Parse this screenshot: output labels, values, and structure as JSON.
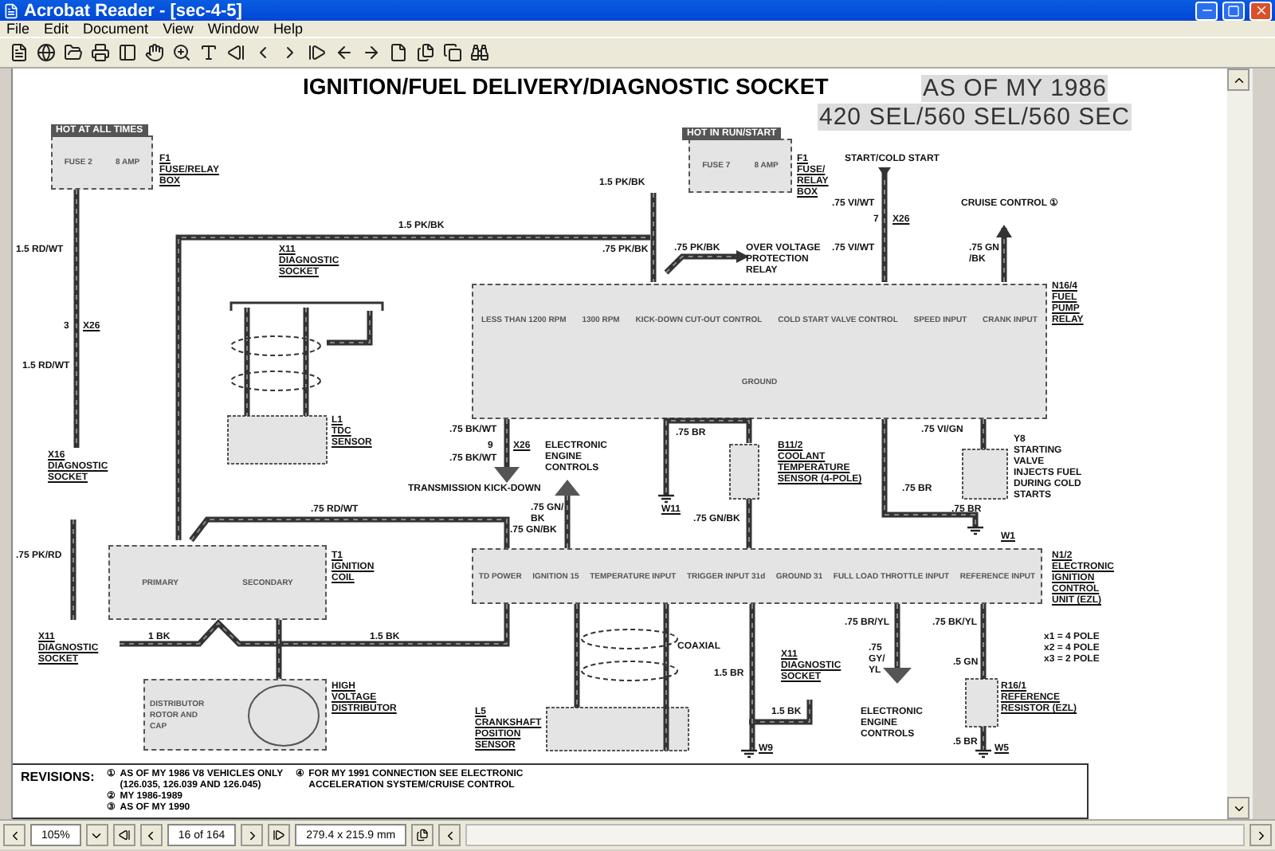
{
  "window": {
    "title": "Acrobat Reader - [sec-4-5]"
  },
  "menu": [
    "File",
    "Edit",
    "Document",
    "View",
    "Window",
    "Help"
  ],
  "document": {
    "title": "IGNITION/FUEL DELIVERY/DIAGNOSTIC SOCKET",
    "edition": "AS OF MY 1986",
    "models": "420 SEL/560 SEL/560 SEC",
    "tags": [
      "HOT AT ALL TIMES",
      "HOT IN RUN/START"
    ],
    "components": [
      {
        "lines": [
          "FUSE 2",
          "8 AMP"
        ]
      },
      {
        "lines": [
          "FUSE 7",
          "8 AMP"
        ]
      },
      {
        "lines": [
          "LESS THAN 1200 RPM",
          "1300 RPM",
          "KICK-DOWN CUT-OUT CONTROL",
          "COLD START VALVE CONTROL",
          "SPEED INPUT",
          "CRANK INPUT",
          "GROUND"
        ]
      },
      {
        "lines": [
          "PRIMARY",
          "SECONDARY"
        ]
      },
      {
        "lines": [
          "TD POWER",
          "IGNITION 15",
          "TEMPERATURE INPUT",
          "TRIGGER INPUT 31d",
          "GROUND 31",
          "FULL LOAD THROTTLE INPUT",
          "REFERENCE INPUT"
        ]
      },
      {
        "lines": [
          "DISTRIBUTOR",
          "ROTOR AND",
          "CAP"
        ]
      }
    ],
    "labels": [
      {
        "lines": [
          "F1",
          "FUSE/RELAY",
          "BOX"
        ],
        "underlined": true
      },
      {
        "lines": [
          "F1",
          "FUSE/",
          "RELAY",
          "BOX"
        ],
        "underlined": true
      },
      {
        "lines": [
          "START/COLD START"
        ],
        "underlined": false
      },
      {
        "lines": [
          "1.5 PK/BK"
        ],
        "underlined": false
      },
      {
        "lines": [
          ".75 VI/WT"
        ],
        "underlined": false
      },
      {
        "lines": [
          "CRUISE CONTROL ①"
        ],
        "underlined": false
      },
      {
        "lines": [
          "1.5 PK/BK"
        ],
        "underlined": false
      },
      {
        "lines": [
          "7"
        ],
        "underlined": false
      },
      {
        "lines": [
          "X26"
        ],
        "underlined": true
      },
      {
        "lines": [
          "1.5 RD/WT"
        ],
        "underlined": false
      },
      {
        "lines": [
          "X11",
          "DIAGNOSTIC",
          "SOCKET"
        ],
        "underlined": true
      },
      {
        "lines": [
          ".75 PK/BK"
        ],
        "underlined": false
      },
      {
        "lines": [
          ".75 PK/BK"
        ],
        "underlined": false
      },
      {
        "lines": [
          "OVER VOLTAGE",
          "PROTECTION",
          "RELAY"
        ],
        "underlined": false
      },
      {
        "lines": [
          ".75 VI/WT"
        ],
        "underlined": false
      },
      {
        "lines": [
          ".75 GN",
          "/BK"
        ],
        "underlined": false
      },
      {
        "lines": [
          "N16/4",
          "FUEL",
          "PUMP",
          "RELAY"
        ],
        "underlined": true
      },
      {
        "lines": [
          "3"
        ],
        "underlined": false
      },
      {
        "lines": [
          "X26"
        ],
        "underlined": true
      },
      {
        "lines": [
          "1.5 RD/WT"
        ],
        "underlined": false
      },
      {
        "lines": [
          "L1",
          "TDC",
          "SENSOR"
        ],
        "underlined": true
      },
      {
        "lines": [
          ".75 BK/WT"
        ],
        "underlined": false
      },
      {
        "lines": [
          ".75 BR"
        ],
        "underlined": false
      },
      {
        "lines": [
          ".75 VI/GN"
        ],
        "underlined": false
      },
      {
        "lines": [
          "X16",
          "DIAGNOSTIC",
          "SOCKET"
        ],
        "underlined": true
      },
      {
        "lines": [
          "9"
        ],
        "underlined": false
      },
      {
        "lines": [
          "X26"
        ],
        "underlined": true
      },
      {
        "lines": [
          ".75 BK/WT"
        ],
        "underlined": false
      },
      {
        "lines": [
          "ELECTRONIC",
          "ENGINE",
          "CONTROLS"
        ],
        "underlined": false
      },
      {
        "lines": [
          "TRANSMISSION KICK-DOWN"
        ],
        "underlined": false
      },
      {
        "lines": [
          "B11/2",
          "COOLANT",
          "TEMPERATURE",
          "SENSOR (4-POLE)"
        ],
        "underlined": true
      },
      {
        "lines": [
          ".75 BR"
        ],
        "underlined": false
      },
      {
        "lines": [
          "Y8",
          "STARTING",
          "VALVE",
          "INJECTS FUEL",
          "DURING COLD",
          "STARTS"
        ],
        "underlined": false
      },
      {
        "lines": [
          ".75 RD/WT"
        ],
        "underlined": false
      },
      {
        "lines": [
          ".75 GN/",
          "BK"
        ],
        "underlined": false
      },
      {
        "lines": [
          "W11"
        ],
        "underlined": true
      },
      {
        "lines": [
          ".75 GN/BK"
        ],
        "underlined": false
      },
      {
        "lines": [
          ".75 BR"
        ],
        "underlined": false
      },
      {
        "lines": [
          ".75 GN/BK"
        ],
        "underlined": false
      },
      {
        "lines": [
          "W1"
        ],
        "underlined": true
      },
      {
        "lines": [
          ".75 PK/RD"
        ],
        "underlined": false
      },
      {
        "lines": [
          "T1",
          "IGNITION",
          "COIL"
        ],
        "underlined": true
      },
      {
        "lines": [
          "N1/2",
          "ELECTRONIC",
          "IGNITION",
          "CONTROL",
          "UNIT (EZL)"
        ],
        "underlined": true
      },
      {
        "lines": [
          ".75 BR/YL"
        ],
        "underlined": false
      },
      {
        "lines": [
          ".75 BK/YL"
        ],
        "underlined": false
      },
      {
        "lines": [
          "X11",
          "DIAGNOSTIC",
          "SOCKET"
        ],
        "underlined": true
      },
      {
        "lines": [
          "1 BK"
        ],
        "underlined": false
      },
      {
        "lines": [
          "1.5 BK"
        ],
        "underlined": false
      },
      {
        "lines": [
          "COAXIAL"
        ],
        "underlined": false
      },
      {
        "lines": [
          "X11",
          "DIAGNOSTIC",
          "SOCKET"
        ],
        "underlined": true
      },
      {
        "lines": [
          ".75",
          "GY/",
          "YL"
        ],
        "underlined": false
      },
      {
        "lines": [
          ".5 GN"
        ],
        "underlined": false
      },
      {
        "lines": [
          "x1 = 4 POLE",
          "x2 = 4 POLE",
          "x3 = 2 POLE"
        ],
        "underlined": false
      },
      {
        "lines": [
          "1.5 BR"
        ],
        "underlined": false
      },
      {
        "lines": [
          "HIGH",
          "VOLTAGE",
          "DISTRIBUTOR"
        ],
        "underlined": true
      },
      {
        "lines": [
          "R16/1",
          "REFERENCE",
          "RESISTOR (EZL)"
        ],
        "underlined": true
      },
      {
        "lines": [
          "L5",
          "CRANKSHAFT",
          "POSITION",
          "SENSOR"
        ],
        "underlined": true
      },
      {
        "lines": [
          "1.5 BK"
        ],
        "underlined": false
      },
      {
        "lines": [
          "ELECTRONIC",
          "ENGINE",
          "CONTROLS"
        ],
        "underlined": false
      },
      {
        "lines": [
          ".5 BR"
        ],
        "underlined": false
      },
      {
        "lines": [
          "W9"
        ],
        "underlined": true
      },
      {
        "lines": [
          "W5"
        ],
        "underlined": true
      }
    ],
    "revisions": {
      "heading": "REVISIONS:",
      "items": [
        {
          "mark": "①",
          "lines": [
            "AS OF MY 1986 V8 VEHICLES ONLY",
            "(126.035, 126.039 AND 126.045)"
          ]
        },
        {
          "mark": "②",
          "lines": [
            "MY 1986-1989"
          ]
        },
        {
          "mark": "③",
          "lines": [
            "AS OF MY 1990"
          ]
        },
        {
          "mark": "④",
          "lines": [
            "FOR MY 1991 CONNECTION SEE ELECTRONIC",
            "ACCELERATION SYSTEM/CRUISE CONTROL"
          ]
        }
      ]
    }
  },
  "status_bar": {
    "zoom": "105%",
    "page": "16 of 164",
    "size": "279.4 x 215.9 mm"
  }
}
